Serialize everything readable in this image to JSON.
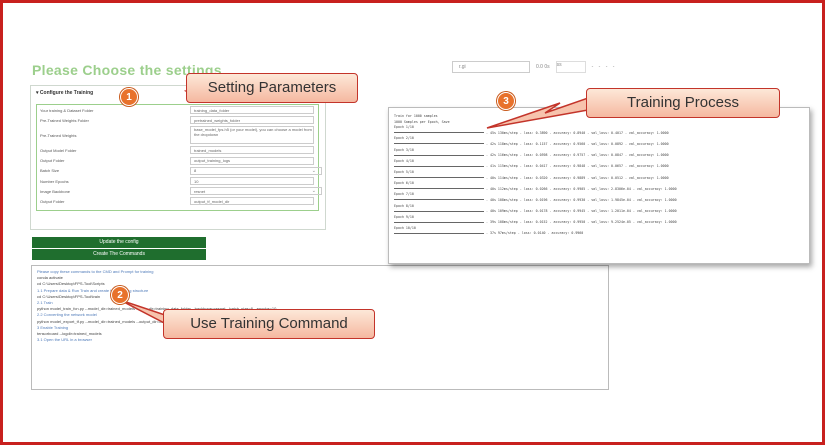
{
  "page": {
    "title": "Please Choose the settings"
  },
  "topbar": {
    "input": "r.gi",
    "field": "0.0 0s",
    "label": "ss",
    "nav": "- - - -"
  },
  "settings": {
    "header": "Configure the Training",
    "rows": [
      {
        "label": "Your training & Dataset Folder",
        "value": "training_data_folder"
      },
      {
        "label": "Pre-Trained Weights Folder",
        "value": "pretrained_weights_folder"
      },
      {
        "label": "Pre-Trained Weights",
        "value": "base_model_fps.h5 (or your model), you can choose a model from the dropdown"
      },
      {
        "label": "Output Model Folder",
        "value": "trained_models"
      },
      {
        "label": "Output Folder",
        "value": "output_training_logs"
      },
      {
        "label": "Batch Size",
        "value": "8"
      },
      {
        "label": "Number Epochs",
        "value": "10"
      },
      {
        "label": "Image Backbone",
        "value": "resnet"
      },
      {
        "label": "Output Folder",
        "value": "output_tf_model_dir"
      }
    ]
  },
  "buttons": {
    "update": "Update the config",
    "create": "Create The Commands"
  },
  "command": {
    "heading": "Please copy these commands to the CMD and Prompt for training",
    "lines": [
      {
        "text": "conda activate",
        "style": ""
      },
      {
        "text": "cd C:\\Users\\Desktop\\FPS-Tool\\Scripts",
        "style": ""
      },
      {
        "text": "1.1 Prepare data & Run Train and create the stacking structure",
        "style": "b"
      },
      {
        "text": "cd C:\\Users\\Desktop\\FPS-Tool\\train",
        "style": ""
      },
      {
        "text": "2.1 Train",
        "style": "b"
      },
      {
        "text": "python model_train_fcn.py --model_dir=trained_models --data_dir=training_data_folder --backbone=resnet --batch_size=8 --epochs=10",
        "style": ""
      },
      {
        "text": "2.2 Converting the network model",
        "style": "b"
      },
      {
        "text": "python model_export_tf.py --model_dir=trained_models --output_dir=output_tf_model_dir",
        "style": ""
      },
      {
        "text": "3 Enable Training",
        "style": "b"
      },
      {
        "text": "tensorboard --logdir=trained_models",
        "style": ""
      },
      {
        "text": "3.1 Open the URL in a browser",
        "style": "b"
      }
    ]
  },
  "terminal": {
    "header": [
      "Train for 1000 samples",
      "1000 Samples per Epoch, Save"
    ],
    "epochs": [
      {
        "label": "Epoch 1/10",
        "stats": "- 45s 130ms/step - loss: 0.3890 - accuracy: 0.8940 - val_loss: 0.4017 - val_accuracy: 1.0000"
      },
      {
        "label": "Epoch 2/10",
        "stats": "- 42s 118ms/step - loss: 0.1157 - accuracy: 0.9560 - val_loss: 0.0892 - val_accuracy: 1.0000"
      },
      {
        "label": "Epoch 3/10",
        "stats": "- 42s 116ms/step - loss: 0.0598 - accuracy: 0.9757 - val_loss: 0.0847 - val_accuracy: 1.0000"
      },
      {
        "label": "Epoch 4/10",
        "stats": "- 41s 115ms/step - loss: 0.0417 - accuracy: 0.9848 - val_loss: 0.0657 - val_accuracy: 1.0000"
      },
      {
        "label": "Epoch 5/10",
        "stats": "- 40s 114ms/step - loss: 0.0320 - accuracy: 0.9889 - val_loss: 0.0512 - val_accuracy: 1.0000"
      },
      {
        "label": "Epoch 6/10",
        "stats": "- 40s 112ms/step - loss: 0.0266 - accuracy: 0.9905 - val_loss: 2.8306e-04 - val_accuracy: 1.0000"
      },
      {
        "label": "Epoch 7/10",
        "stats": "- 40s 108ms/step - loss: 0.0196 - accuracy: 0.9930 - val_loss: 1.9845e-04 - val_accuracy: 1.0000"
      },
      {
        "label": "Epoch 8/10",
        "stats": "- 40s 109ms/step - loss: 0.0178 - accuracy: 0.9945 - val_loss: 1.2011e-04 - val_accuracy: 1.0000"
      },
      {
        "label": "Epoch 9/10",
        "stats": "- 39s 108ms/step - loss: 0.0152 - accuracy: 0.9950 - val_loss: 9.2524e-05 - val_accuracy: 1.0000"
      },
      {
        "label": "Epoch 10/10",
        "stats": "- 37s 97ms/step - loss: 0.0140 - accuracy: 0.9960"
      }
    ]
  },
  "callouts": [
    {
      "badge": "1",
      "text": "Setting Parameters"
    },
    {
      "badge": "2",
      "text": "Use Training Command"
    },
    {
      "badge": "3",
      "text": "Training Process"
    }
  ],
  "colors": {
    "frame": "#c8201e",
    "title": "#9ccf8c",
    "button": "#1f6e2e",
    "badge": "#e8722c",
    "callout_border": "#c3342a"
  }
}
